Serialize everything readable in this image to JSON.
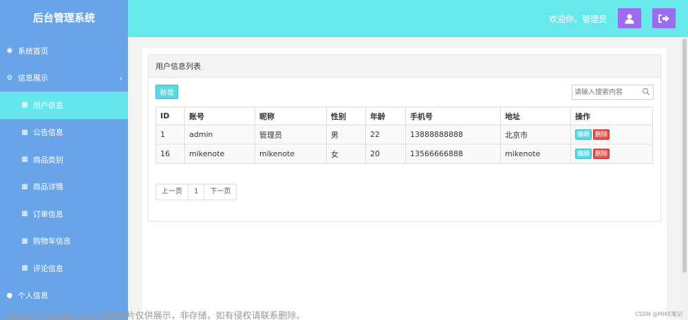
{
  "app": {
    "title": "后台管理系统"
  },
  "sidebar": {
    "items": [
      {
        "label": "系统首页",
        "icon": "dashboard-icon"
      },
      {
        "label": "信息展示",
        "icon": "gears-icon"
      },
      {
        "label": "用户信息",
        "icon": "table-icon",
        "active": true
      },
      {
        "label": "公告信息",
        "icon": "table-icon"
      },
      {
        "label": "商品类别",
        "icon": "table-icon"
      },
      {
        "label": "商品详情",
        "icon": "table-icon"
      },
      {
        "label": "订单信息",
        "icon": "table-icon"
      },
      {
        "label": "购物车信息",
        "icon": "table-icon"
      },
      {
        "label": "评论信息",
        "icon": "table-icon"
      },
      {
        "label": "个人信息",
        "icon": "user-icon"
      }
    ]
  },
  "header": {
    "welcome": "欢迎你，管理员"
  },
  "panel": {
    "title": "用户信息列表",
    "add_label": "新增",
    "search_placeholder": "请输入搜索内容"
  },
  "table": {
    "columns": [
      "ID",
      "账号",
      "昵称",
      "性别",
      "年龄",
      "手机号",
      "地址",
      "操作"
    ],
    "rows": [
      [
        "1",
        "admin",
        "管理员",
        "男",
        "22",
        "13888888888",
        "北京市"
      ],
      [
        "16",
        "mikenote",
        "mikenote",
        "女",
        "20",
        "13566666888",
        "mikenote"
      ]
    ],
    "edit_label": "编辑",
    "delete_label": "删除"
  },
  "pagination": {
    "prev": "上一页",
    "page": "1",
    "next": "下一页"
  },
  "overlay": {
    "watermark": "www.toymoban.com 网络图片仅供展示，非存储，如有侵权请联系删除。",
    "credit": "CSDN @MIKE笔记"
  },
  "colors": {
    "sidebar": "#6aa4e8",
    "topbar": "#67e9ec",
    "active_item": "#67e6ee",
    "top_button": "#9b6cf0",
    "add_button": "#5bd8e0",
    "delete_button": "#e0534f"
  }
}
